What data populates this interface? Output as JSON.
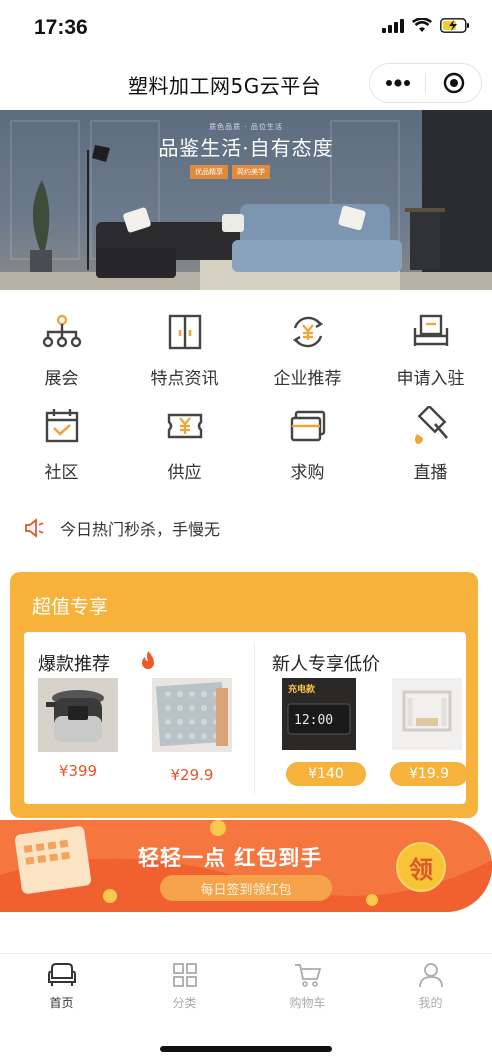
{
  "status_bar": {
    "time": "17:36"
  },
  "nav": {
    "title": "塑料加工网5G云平台"
  },
  "banner": {
    "heading": "品鉴生活·自有态度",
    "small_text": "质色品质 · 品位生活",
    "tags": [
      "优品精享",
      "简约美学"
    ]
  },
  "menu": {
    "items": [
      {
        "label": "展会",
        "icon": "network-icon"
      },
      {
        "label": "特点资讯",
        "icon": "cabinet-icon"
      },
      {
        "label": "企业推荐",
        "icon": "yen-refresh-icon"
      },
      {
        "label": "申请入驻",
        "icon": "armchair-icon"
      },
      {
        "label": "社区",
        "icon": "calendar-check-icon"
      },
      {
        "label": "供应",
        "icon": "yen-ticket-icon"
      },
      {
        "label": "求购",
        "icon": "cards-icon"
      },
      {
        "label": "直播",
        "icon": "gavel-icon"
      }
    ]
  },
  "notice": {
    "text": "今日热门秒杀，手慢无",
    "icon": "speaker-icon"
  },
  "super_deal": {
    "title": "超值专享",
    "left": {
      "title": "爆款推荐",
      "badge_icon": "fire-icon",
      "products": [
        {
          "price": "¥399",
          "image": "pressure-cooker"
        },
        {
          "price": "¥29.9",
          "image": "foam-mats"
        }
      ]
    },
    "right": {
      "title": "新人专享低价",
      "products": [
        {
          "price": "¥140",
          "image": "led-clock",
          "image_text": "充电款"
        },
        {
          "price": "¥19.9",
          "image": "white-hanger"
        }
      ]
    }
  },
  "red_packet": {
    "main": "轻轻一点 红包到手",
    "sub": "每日签到领红包",
    "badge": "领"
  },
  "tab_bar": {
    "tabs": [
      {
        "label": "首页",
        "icon": "sofa-icon",
        "active": true
      },
      {
        "label": "分类",
        "icon": "grid-icon",
        "active": false
      },
      {
        "label": "购物车",
        "icon": "cart-icon",
        "active": false
      },
      {
        "label": "我的",
        "icon": "user-icon",
        "active": false
      }
    ]
  },
  "colors": {
    "accent": "#f6b23b",
    "price": "#e4552c",
    "icon": "#444444",
    "icon_accent": "#f0a53a"
  }
}
